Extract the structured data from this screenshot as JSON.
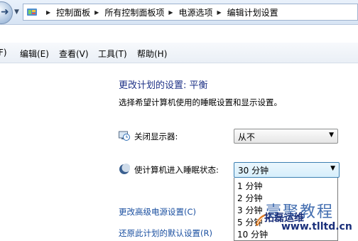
{
  "breadcrumb": {
    "items": [
      "控制面板",
      "所有控制面板项",
      "电源选项",
      "编辑计划设置"
    ]
  },
  "menu": {
    "file": "F)",
    "edit": "编辑(E)",
    "view": "查看(V)",
    "tools": "工具(T)",
    "help": "帮助(H)"
  },
  "page": {
    "title": "更改计划的设置: 平衡",
    "subtitle": "选择希望计算机使用的睡眠设置和显示设置。"
  },
  "settings": {
    "display_off": {
      "label": "关闭显示器:",
      "value": "从不"
    },
    "sleep": {
      "label": "使计算机进入睡眠状态:",
      "value": "30 分钟"
    }
  },
  "dropdown_options": [
    "1 分钟",
    "2 分钟",
    "3 分钟",
    "5 分钟",
    "10 分钟"
  ],
  "links": {
    "advanced": "更改高级电源设置(C)",
    "restore": "还原此计划的默认设置(R)"
  },
  "watermark": {
    "brand": "壹聚教程",
    "brand2": "拓磊运维",
    "url": "www.tlltd.cn"
  }
}
